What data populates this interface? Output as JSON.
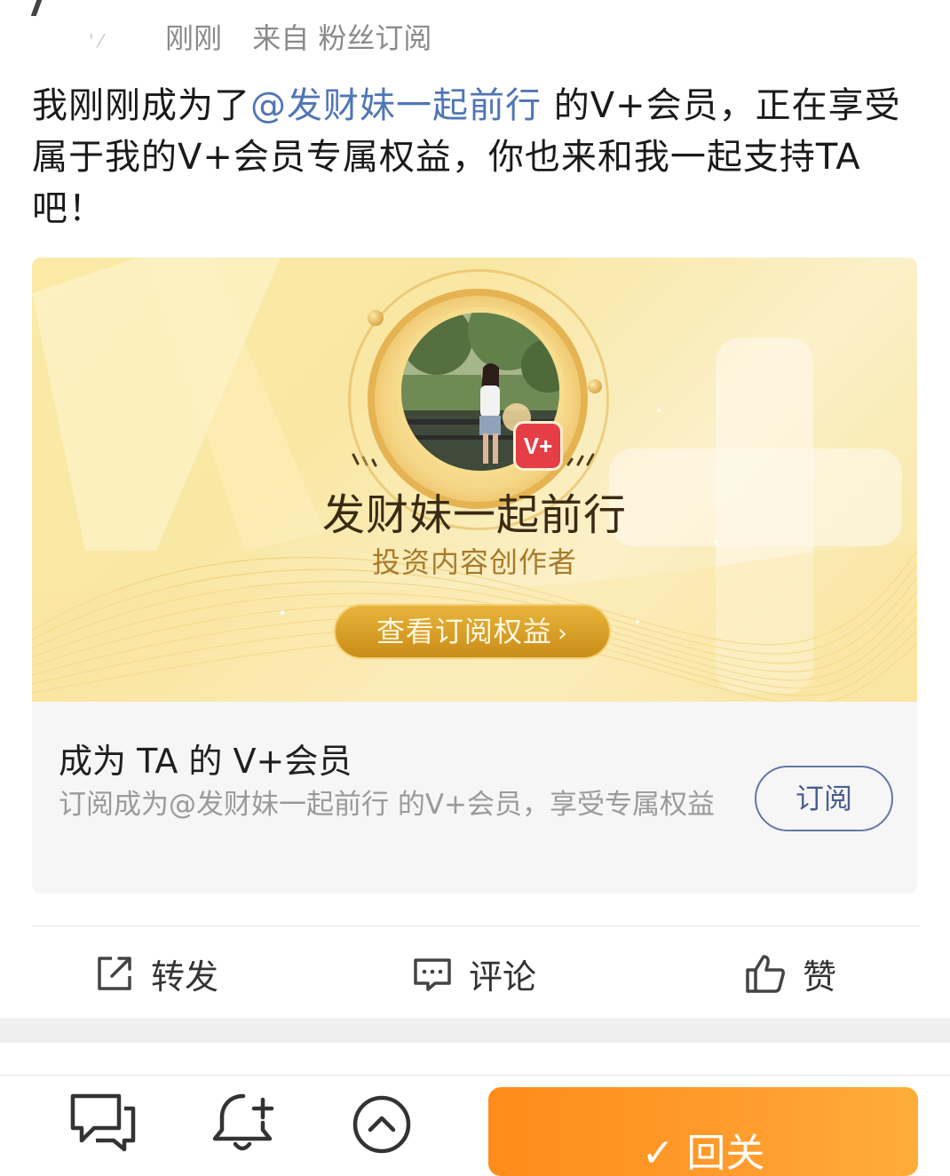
{
  "meta": {
    "time": "刚刚",
    "source": "来自 粉丝订阅"
  },
  "post": {
    "prefix": "我刚刚成为了",
    "mention": "@发财妹一起前行",
    "suffix": " 的V+会员，正在享受属于我的V+会员专属权益，你也来和我一起支持TA吧！"
  },
  "banner": {
    "creator_name": "发财妹一起前行",
    "creator_role": "投资内容创作者",
    "view_button": "查看订阅权益",
    "badge": "V+"
  },
  "subscribe": {
    "title": "成为 TA 的 V+会员",
    "desc": "订阅成为@发财妹一起前行 的V+会员，享受专属权益",
    "button": "订阅"
  },
  "actions": {
    "repost": "转发",
    "comment": "评论",
    "like": "赞"
  },
  "bottom_bar": {
    "follow": "✓ 回关"
  },
  "colors": {
    "accent_orange": "#ff8c1a",
    "mention_blue": "#4f76b5",
    "gold": "#e5b352"
  }
}
